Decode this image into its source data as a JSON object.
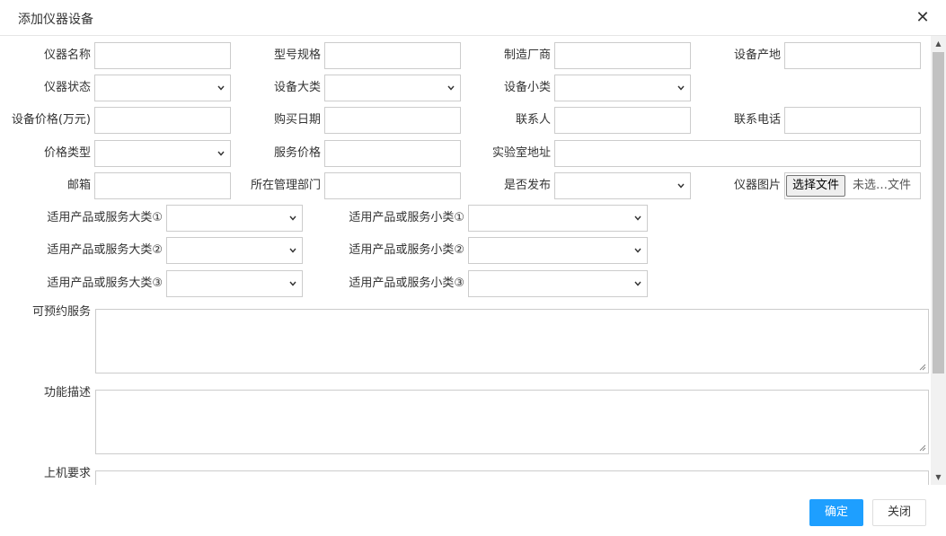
{
  "dialog": {
    "title": "添加仪器设备",
    "close_icon": "close-icon"
  },
  "row1": {
    "name": "仪器名称",
    "model": "型号规格",
    "maker": "制造厂商",
    "origin": "设备产地"
  },
  "row2": {
    "status": "仪器状态",
    "major": "设备大类",
    "minor": "设备小类"
  },
  "row3": {
    "price": "设备价格(万元)",
    "buy_date": "购买日期",
    "contact": "联系人",
    "phone": "联系电话"
  },
  "row4": {
    "price_type": "价格类型",
    "service_price": "服务价格",
    "lab_addr": "实验室地址"
  },
  "row5": {
    "email": "邮箱",
    "dept": "所在管理部门",
    "publish": "是否发布",
    "image": "仪器图片"
  },
  "file": {
    "button": "选择文件",
    "status": "未选…文件"
  },
  "applicable": [
    {
      "major": "适用产品或服务大类①",
      "minor": "适用产品或服务小类①"
    },
    {
      "major": "适用产品或服务大类②",
      "minor": "适用产品或服务小类②"
    },
    {
      "major": "适用产品或服务大类③",
      "minor": "适用产品或服务小类③"
    }
  ],
  "textareas": {
    "bookable": "可预约服务",
    "function": "功能描述",
    "requirement": "上机要求"
  },
  "footer": {
    "ok": "确定",
    "close": "关闭"
  },
  "colors": {
    "primary": "#1e9fff",
    "border": "#cccccc"
  }
}
